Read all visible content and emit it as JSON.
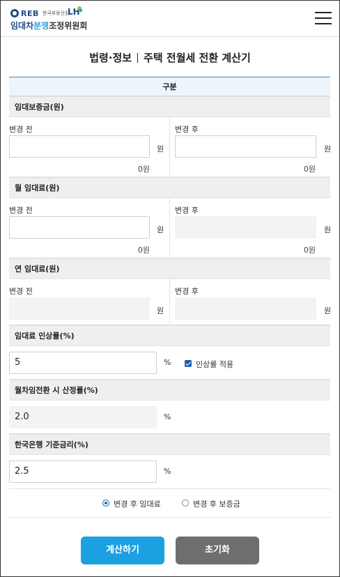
{
  "header": {
    "reb_logo": "REB",
    "reb_sub": "한국부동산원",
    "lh_logo": "LH",
    "committee_part1": "임대차",
    "committee_part2": "분쟁",
    "committee_part3": "조정위원회",
    "menu_icon": "hamburger-menu-icon"
  },
  "page": {
    "breadcrumb": "법령·정보",
    "title": "주택 전월세 전환 계산기"
  },
  "table": {
    "header": "구분",
    "deposit": {
      "label": "임대보증금(원)",
      "before_label": "변경 전",
      "after_label": "변경 후",
      "before_value": "",
      "after_value": "",
      "unit": "원",
      "before_hint": "0원",
      "after_hint": "0원"
    },
    "monthly_rent": {
      "label": "월 임대료(원)",
      "before_label": "변경 전",
      "after_label": "변경 후",
      "before_value": "",
      "after_value": "",
      "unit": "원",
      "before_hint": "0원",
      "after_hint": "0원"
    },
    "annual_rent": {
      "label": "연 임대료(원)",
      "before_label": "변경 전",
      "after_label": "변경 후",
      "unit": "원"
    },
    "increase_rate": {
      "label": "임대료 인상률(%)",
      "value": "5",
      "unit": "%",
      "checkbox_label": "인상률 적용",
      "checked": true
    },
    "conversion_rate": {
      "label": "월차임전환 시 산정률(%)",
      "value": "2.0",
      "unit": "%"
    },
    "base_rate": {
      "label": "한국은행 기준금리(%)",
      "value": "2.5",
      "unit": "%"
    },
    "mode": {
      "option1": "변경 후 임대료",
      "option2": "변경 후 보증금",
      "selected": "option1"
    }
  },
  "buttons": {
    "calculate": "계산하기",
    "reset": "초기화"
  },
  "colors": {
    "primary": "#1ba0e2",
    "secondary": "#6e6e6e",
    "brand_blue": "#1f4a8c",
    "accent_line": "#2c86c8"
  }
}
